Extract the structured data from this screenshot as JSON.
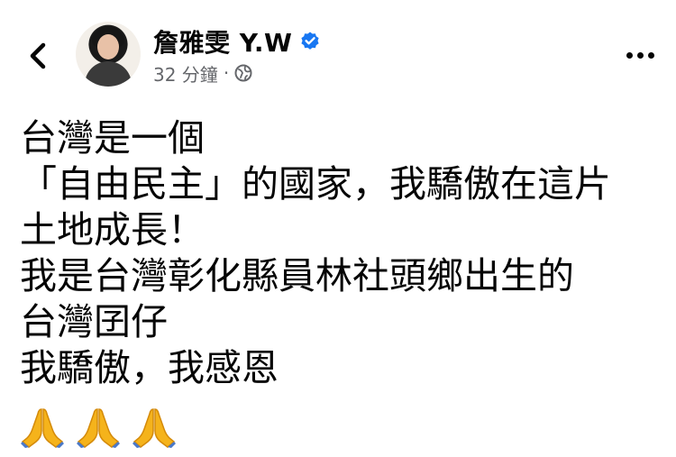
{
  "post": {
    "author_name": "詹雅雯 Y.W",
    "time_ago": "32 分鐘",
    "separator": "·",
    "privacy_icon": "globe-icon",
    "verified_icon": "verified-badge-icon",
    "lines": [
      "台灣是一個",
      "「自由民主」的國家，我驕傲在這片",
      "土地成長！",
      "我是台灣彰化縣員林社頭鄉出生的",
      "台灣囝仔",
      "我驕傲，我感恩"
    ],
    "emoji": [
      "folded-hands-icon",
      "folded-hands-icon",
      "folded-hands-icon"
    ]
  },
  "nav": {
    "back_icon": "chevron-left-icon",
    "more_icon": "more-horizontal-icon"
  },
  "colors": {
    "text": "#050505",
    "meta": "#65676b",
    "verified": "#1877f2",
    "emoji": "#f5b31b"
  }
}
